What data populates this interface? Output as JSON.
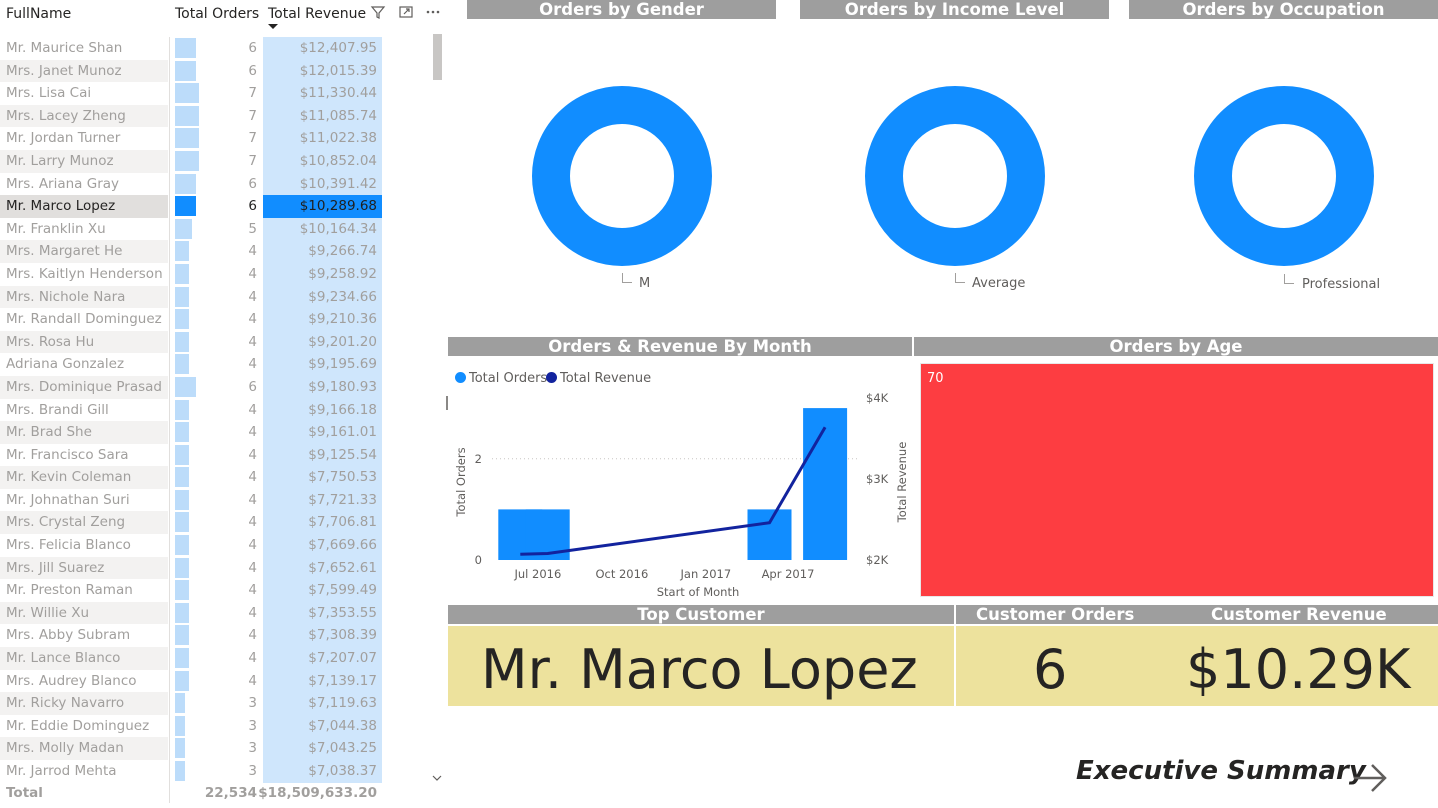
{
  "table": {
    "headers": {
      "name": "FullName",
      "orders": "Total Orders",
      "revenue": "Total Revenue"
    },
    "header_icons": [
      "filter-icon",
      "focus-mode-icon",
      "more-options-icon"
    ],
    "rows": [
      {
        "name": "Mr. Maurice Shan",
        "orders": "6",
        "revenue": "$12,407.95"
      },
      {
        "name": "Mrs. Janet Munoz",
        "orders": "6",
        "revenue": "$12,015.39"
      },
      {
        "name": "Mrs. Lisa Cai",
        "orders": "7",
        "revenue": "$11,330.44"
      },
      {
        "name": "Mrs. Lacey Zheng",
        "orders": "7",
        "revenue": "$11,085.74"
      },
      {
        "name": "Mr. Jordan Turner",
        "orders": "7",
        "revenue": "$11,022.38"
      },
      {
        "name": "Mr. Larry Munoz",
        "orders": "7",
        "revenue": "$10,852.04"
      },
      {
        "name": "Mrs. Ariana Gray",
        "orders": "6",
        "revenue": "$10,391.42"
      },
      {
        "name": "Mr. Marco Lopez",
        "orders": "6",
        "revenue": "$10,289.68",
        "selected": true
      },
      {
        "name": "Mr. Franklin Xu",
        "orders": "5",
        "revenue": "$10,164.34"
      },
      {
        "name": "Mrs. Margaret He",
        "orders": "4",
        "revenue": "$9,266.74"
      },
      {
        "name": "Mrs. Kaitlyn Henderson",
        "orders": "4",
        "revenue": "$9,258.92"
      },
      {
        "name": "Mrs. Nichole Nara",
        "orders": "4",
        "revenue": "$9,234.66"
      },
      {
        "name": "Mr. Randall Dominguez",
        "orders": "4",
        "revenue": "$9,210.36"
      },
      {
        "name": "Mrs. Rosa Hu",
        "orders": "4",
        "revenue": "$9,201.20"
      },
      {
        "name": "Adriana Gonzalez",
        "orders": "4",
        "revenue": "$9,195.69"
      },
      {
        "name": "Mrs. Dominique Prasad",
        "orders": "6",
        "revenue": "$9,180.93"
      },
      {
        "name": "Mrs. Brandi Gill",
        "orders": "4",
        "revenue": "$9,166.18"
      },
      {
        "name": "Mr. Brad She",
        "orders": "4",
        "revenue": "$9,161.01"
      },
      {
        "name": "Mr. Francisco Sara",
        "orders": "4",
        "revenue": "$9,125.54"
      },
      {
        "name": "Mr. Kevin Coleman",
        "orders": "4",
        "revenue": "$7,750.53"
      },
      {
        "name": "Mr. Johnathan Suri",
        "orders": "4",
        "revenue": "$7,721.33"
      },
      {
        "name": "Mrs. Crystal Zeng",
        "orders": "4",
        "revenue": "$7,706.81"
      },
      {
        "name": "Mrs. Felicia Blanco",
        "orders": "4",
        "revenue": "$7,669.66"
      },
      {
        "name": "Mrs. Jill Suarez",
        "orders": "4",
        "revenue": "$7,652.61"
      },
      {
        "name": "Mr. Preston Raman",
        "orders": "4",
        "revenue": "$7,599.49"
      },
      {
        "name": "Mr. Willie Xu",
        "orders": "4",
        "revenue": "$7,353.55"
      },
      {
        "name": "Mrs. Abby Subram",
        "orders": "4",
        "revenue": "$7,308.39"
      },
      {
        "name": "Mr. Lance Blanco",
        "orders": "4",
        "revenue": "$7,207.07"
      },
      {
        "name": "Mrs. Audrey Blanco",
        "orders": "4",
        "revenue": "$7,139.17"
      },
      {
        "name": "Mr. Ricky Navarro",
        "orders": "3",
        "revenue": "$7,119.63"
      },
      {
        "name": "Mr. Eddie Dominguez",
        "orders": "3",
        "revenue": "$7,044.38"
      },
      {
        "name": "Mrs. Molly Madan",
        "orders": "3",
        "revenue": "$7,043.25"
      },
      {
        "name": "Mr. Jarrod Mehta",
        "orders": "3",
        "revenue": "$7,038.37"
      }
    ],
    "orders_bar_max": 7,
    "total": {
      "label": "Total",
      "orders": "22,534",
      "revenue": "$18,509,633.20"
    },
    "scroll_icons": {
      "down": "chevron-down-icon"
    }
  },
  "donuts": [
    {
      "title": "Orders by Gender",
      "label": "M",
      "color": "#118dff"
    },
    {
      "title": "Orders by Income Level",
      "label": "Average",
      "color": "#118dff"
    },
    {
      "title": "Orders by Occupation",
      "label": "Professional",
      "color": "#118dff"
    }
  ],
  "combo": {
    "title": "Orders & Revenue By Month",
    "legend": [
      {
        "name": "Total Orders",
        "color": "#118dff"
      },
      {
        "name": "Total Revenue",
        "color": "#12239e"
      }
    ],
    "y_left_label": "Total Orders",
    "y_right_label": "Total Revenue",
    "x_label": "Start of Month",
    "y_left_ticks": [
      "0",
      "2"
    ],
    "y_right_ticks": [
      "$2K",
      "$3K",
      "$4K"
    ],
    "x_ticks": [
      "Jul 2016",
      "Oct 2016",
      "Jan 2017",
      "Apr 2017"
    ]
  },
  "chart_data": {
    "type": "bar",
    "title": "Orders & Revenue By Month",
    "xlabel": "Start of Month",
    "ylabel": "Total Orders",
    "y2label": "Total Revenue",
    "categories": [
      "2016-06",
      "2016-07",
      "2017-03",
      "2017-05"
    ],
    "series": [
      {
        "name": "Total Orders",
        "type": "bar",
        "axis": "left",
        "values": [
          1,
          1,
          1,
          3
        ]
      },
      {
        "name": "Total Revenue",
        "type": "line",
        "axis": "right",
        "values": [
          2070,
          2080,
          2460,
          3640
        ]
      }
    ],
    "ylim": [
      0,
      3.2
    ],
    "y2lim": [
      2000,
      4000
    ],
    "legend": "top-left"
  },
  "age": {
    "title": "Orders by Age",
    "value_label": "70",
    "color": "#fd3d41"
  },
  "kpi": {
    "top_customer_title": "Top Customer",
    "top_customer": "Mr. Marco Lopez",
    "orders_title": "Customer Orders",
    "orders": "6",
    "revenue_title": "Customer Revenue",
    "revenue": "$10.29K",
    "band_color": "#ede29d"
  },
  "nav": {
    "label": "Executive Summary",
    "icon": "arrow-right-icon"
  }
}
